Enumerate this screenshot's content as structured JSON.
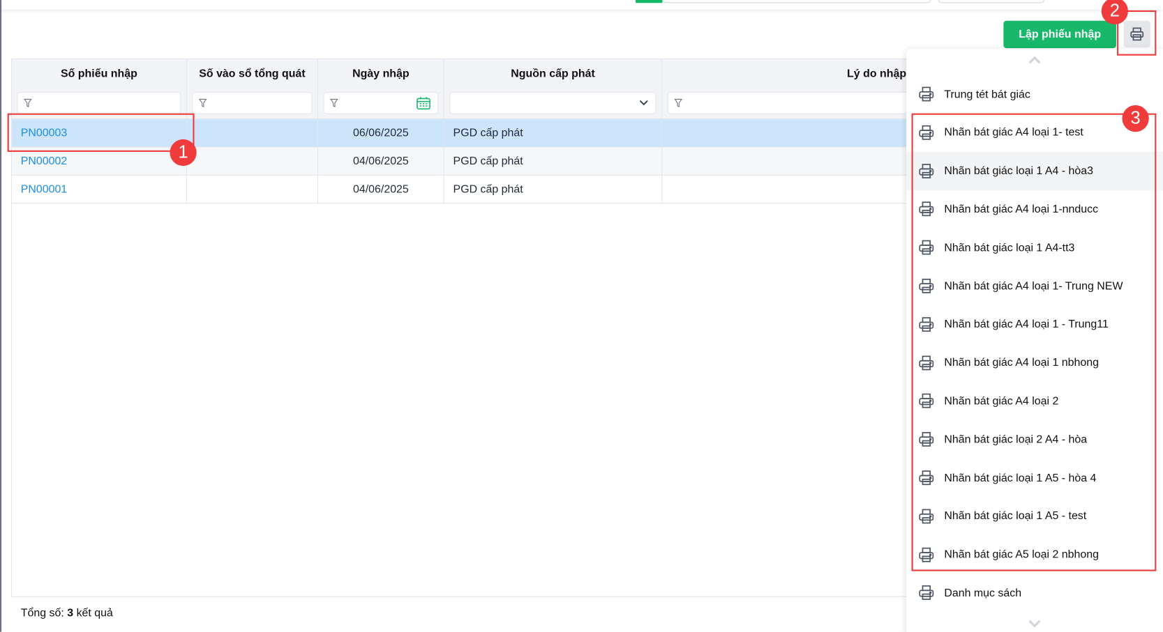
{
  "toolbar": {
    "create_label": "Lập phiếu nhập",
    "print_icon": "printer-icon"
  },
  "table": {
    "columns": [
      "Số phiếu nhập",
      "Số vào sổ tổng quát",
      "Ngày nhập",
      "Nguồn cấp phát",
      "Lý do nhập"
    ],
    "rows": [
      {
        "code": "PN00003",
        "ledger": "",
        "date": "06/06/2025",
        "source": "PGD cấp phát",
        "reason": ""
      },
      {
        "code": "PN00002",
        "ledger": "",
        "date": "04/06/2025",
        "source": "PGD cấp phát",
        "reason": ""
      },
      {
        "code": "PN00001",
        "ledger": "",
        "date": "04/06/2025",
        "source": "PGD cấp phát",
        "reason": ""
      }
    ],
    "selected_row": 0
  },
  "footer": {
    "prefix": "Tổng số:",
    "count": "3",
    "suffix": "kết quả"
  },
  "print_menu": {
    "items": [
      "Trung tét bát giác",
      "Nhãn bát giác A4 loại 1- test",
      "Nhãn bát giác loại 1 A4 - hòa3",
      "Nhãn bát giác A4 loại 1-nnducc",
      "Nhãn bát giác loại 1 A4-tt3",
      "Nhãn bát giác A4 loại 1- Trung NEW",
      "Nhãn bát giác A4 loại 1 - Trung11",
      "Nhãn bát giác A4 loại 1 nbhong",
      "Nhãn bát giác A4 loại 2",
      "Nhãn bát giác loại 2 A4 - hòa",
      "Nhãn bát giác loại 1 A5 - hòa 4",
      "Nhãn bát giác loại 1 A5 - test",
      "Nhãn bát giác A5 loại 2 nbhong",
      "Danh mục sách"
    ],
    "hovered_index": 2
  },
  "annotations": [
    "1",
    "2",
    "3"
  ],
  "colors": {
    "primary": "#17b86a",
    "link": "#1a8fe3",
    "selected_row": "#cce5fb",
    "annotation": "#ef3b3b"
  }
}
